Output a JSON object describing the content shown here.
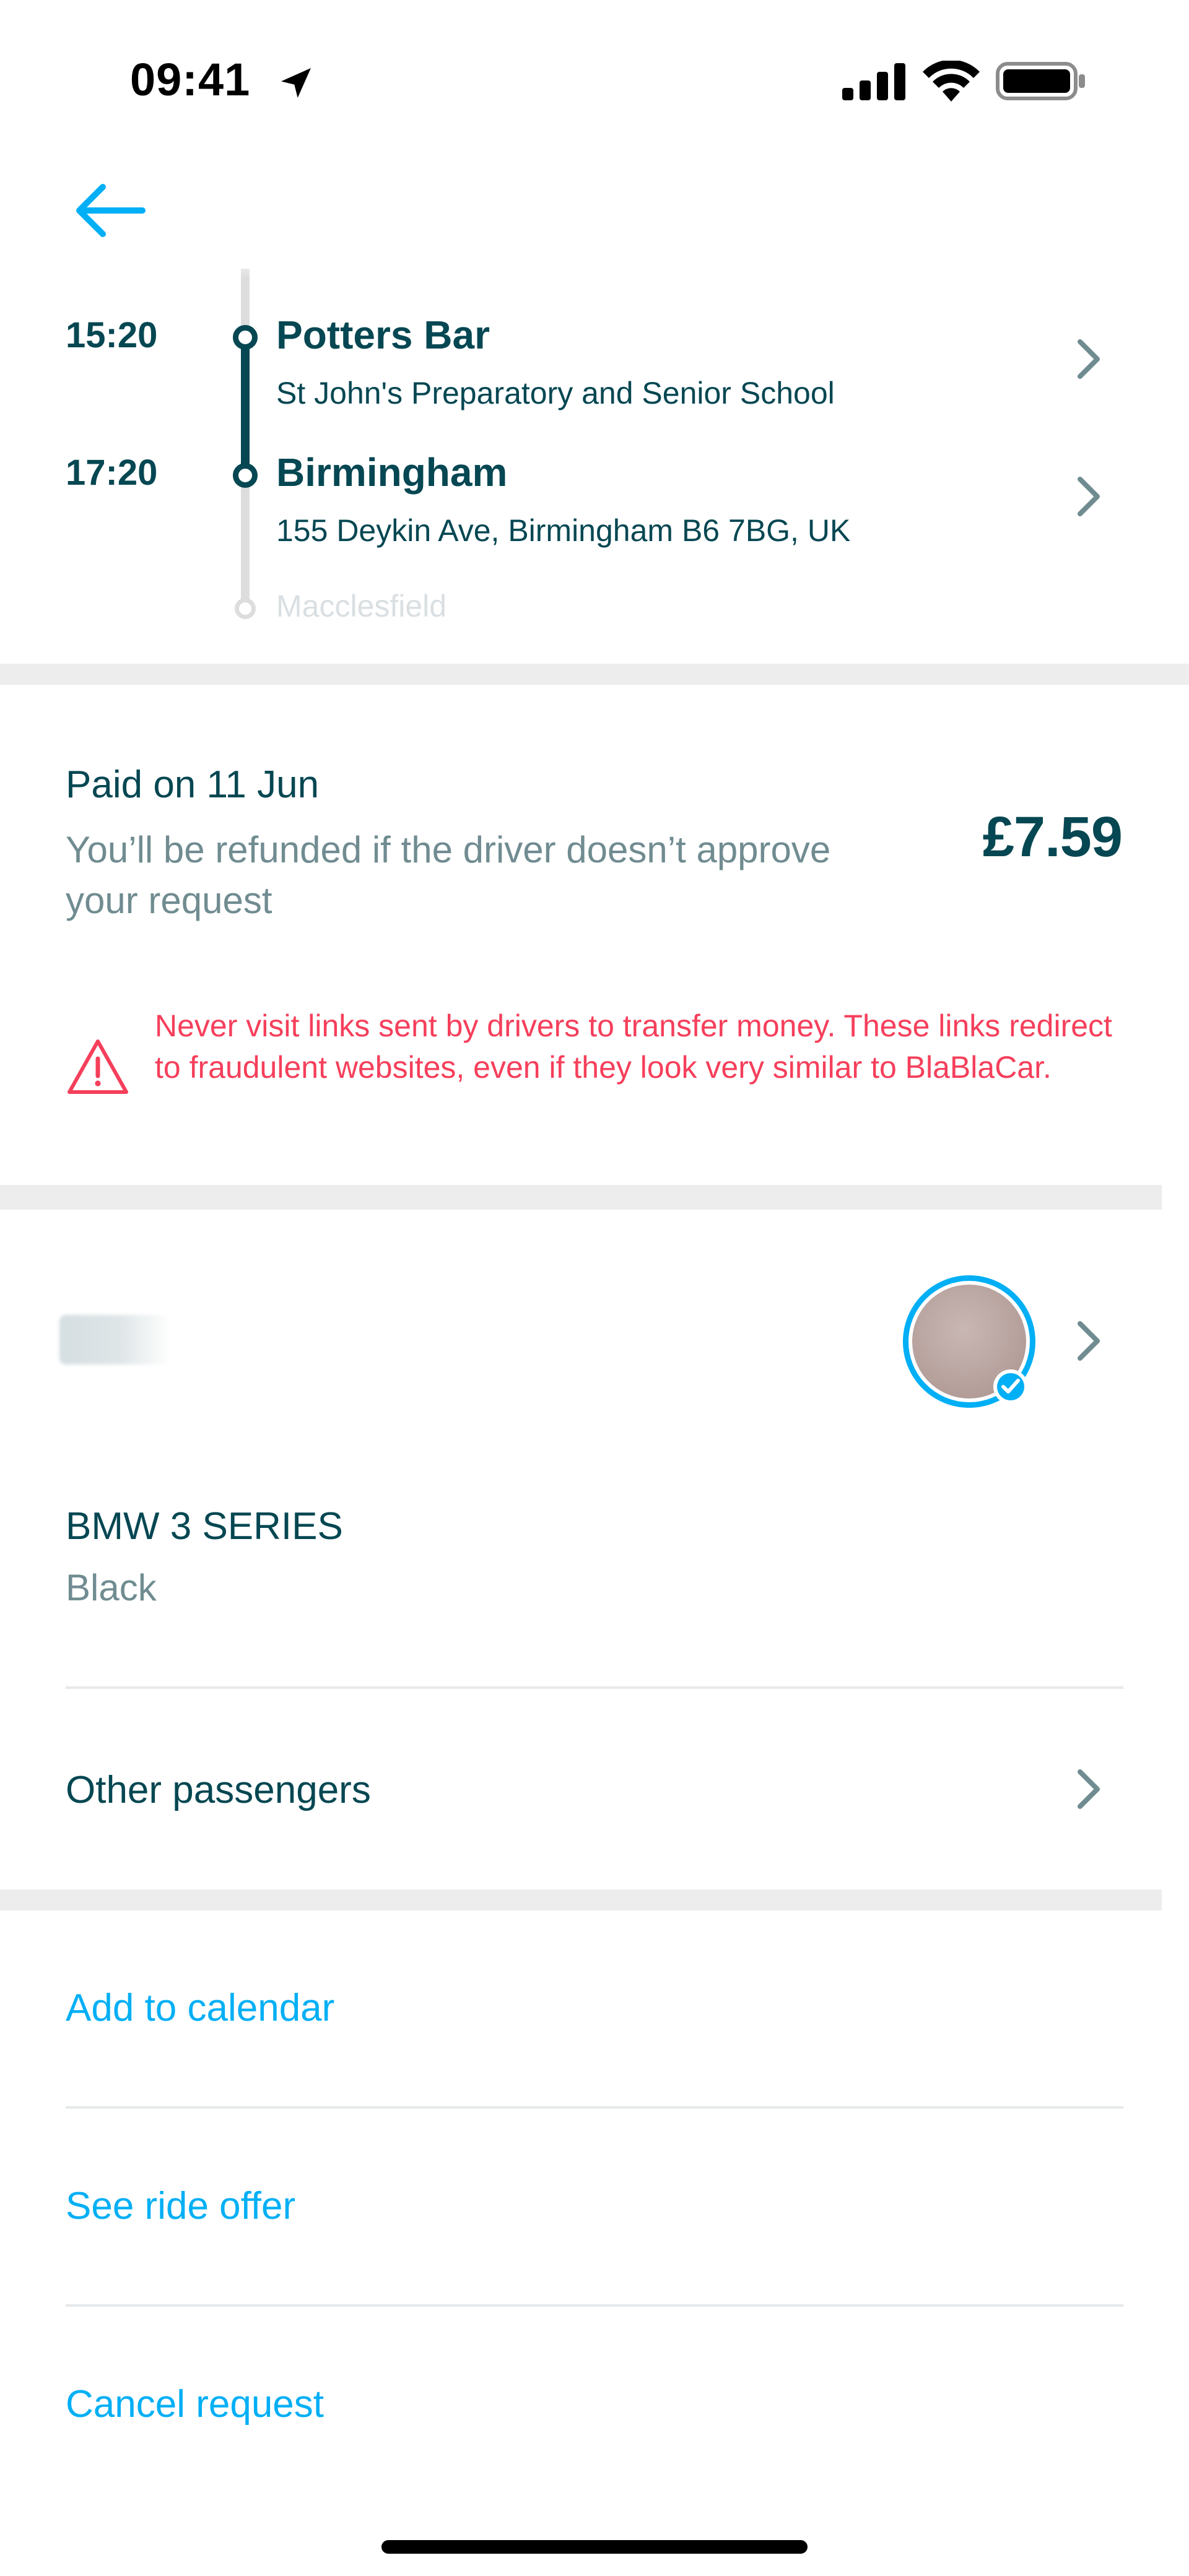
{
  "status_bar": {
    "time": "09:41",
    "icons": [
      "location-arrow-icon",
      "cellular-signal-icon",
      "wifi-icon",
      "battery-icon"
    ]
  },
  "header": {
    "back_icon": "arrow-left-icon"
  },
  "itinerary": {
    "stops": [
      {
        "time": "15:20",
        "name": "Potters Bar",
        "address": "St John's Preparatory and Senior School"
      },
      {
        "time": "17:20",
        "name": "Birmingham",
        "address": "155 Deykin Ave, Birmingham B6 7BG, UK"
      }
    ],
    "next_stop": "Macclesfield"
  },
  "payment": {
    "paid_label": "Paid on 11 Jun",
    "refund_note": "You’ll be refunded if the driver doesn’t approve your request",
    "price": "£7.59"
  },
  "warning": {
    "text": "Never visit links sent by drivers to transfer money. These links redirect to fraudulent websites, even if they look very similar to BlaBlaCar."
  },
  "vehicle": {
    "model": "BMW 3 SERIES",
    "color": "Black"
  },
  "passengers": {
    "label": "Other passengers"
  },
  "actions": {
    "add_to_calendar": "Add to calendar",
    "see_ride_offer": "See ride offer",
    "cancel_request": "Cancel request"
  },
  "colors": {
    "primary_text": "#054752",
    "secondary_text": "#708c91",
    "accent": "#00aff5",
    "warning": "#f53f5b",
    "separator": "#ededed"
  }
}
